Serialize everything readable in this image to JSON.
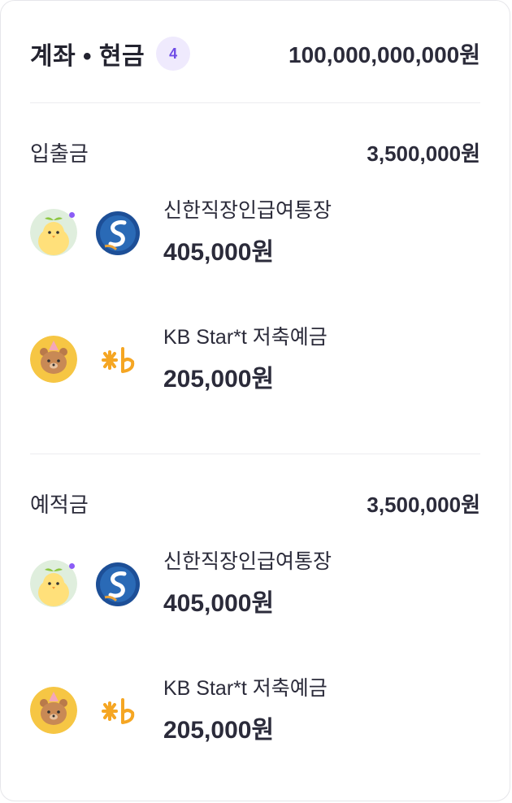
{
  "header": {
    "title": "계좌 • 현금",
    "count": "4",
    "total": "100,000,000,000원"
  },
  "colors": {
    "accent": "#6f4ce6",
    "badge_bg": "#efeafd",
    "text": "#2b2b3a",
    "divider": "#ececf0"
  },
  "sections": [
    {
      "title": "입출금",
      "total": "3,500,000원",
      "accounts": [
        {
          "name": "신한직장인급여통장",
          "amount": "405,000원",
          "avatar": "chick-avatar-icon",
          "bank": "shinhan-logo-icon"
        },
        {
          "name": "KB Star*t 저축예금",
          "amount": "205,000원",
          "avatar": "bear-avatar-icon",
          "bank": "kb-logo-icon"
        }
      ]
    },
    {
      "title": "예적금",
      "total": "3,500,000원",
      "accounts": [
        {
          "name": "신한직장인급여통장",
          "amount": "405,000원",
          "avatar": "chick-avatar-icon",
          "bank": "shinhan-logo-icon"
        },
        {
          "name": "KB Star*t 저축예금",
          "amount": "205,000원",
          "avatar": "bear-avatar-icon",
          "bank": "kb-logo-icon"
        }
      ]
    }
  ]
}
